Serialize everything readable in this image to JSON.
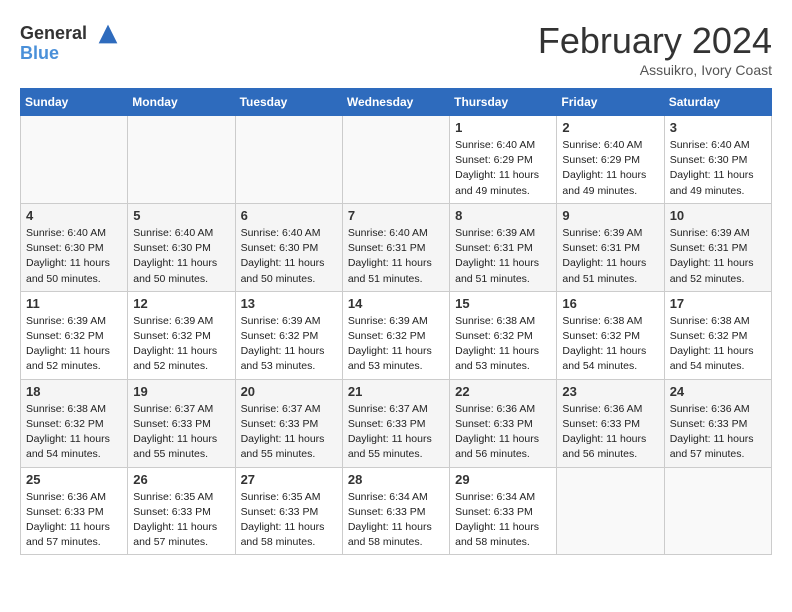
{
  "header": {
    "logo_line1": "General",
    "logo_line2": "Blue",
    "month_title": "February 2024",
    "subtitle": "Assuikro, Ivory Coast"
  },
  "days_of_week": [
    "Sunday",
    "Monday",
    "Tuesday",
    "Wednesday",
    "Thursday",
    "Friday",
    "Saturday"
  ],
  "weeks": [
    [
      {
        "day": "",
        "info": ""
      },
      {
        "day": "",
        "info": ""
      },
      {
        "day": "",
        "info": ""
      },
      {
        "day": "",
        "info": ""
      },
      {
        "day": "1",
        "info": "Sunrise: 6:40 AM\nSunset: 6:29 PM\nDaylight: 11 hours\nand 49 minutes."
      },
      {
        "day": "2",
        "info": "Sunrise: 6:40 AM\nSunset: 6:29 PM\nDaylight: 11 hours\nand 49 minutes."
      },
      {
        "day": "3",
        "info": "Sunrise: 6:40 AM\nSunset: 6:30 PM\nDaylight: 11 hours\nand 49 minutes."
      }
    ],
    [
      {
        "day": "4",
        "info": "Sunrise: 6:40 AM\nSunset: 6:30 PM\nDaylight: 11 hours\nand 50 minutes."
      },
      {
        "day": "5",
        "info": "Sunrise: 6:40 AM\nSunset: 6:30 PM\nDaylight: 11 hours\nand 50 minutes."
      },
      {
        "day": "6",
        "info": "Sunrise: 6:40 AM\nSunset: 6:30 PM\nDaylight: 11 hours\nand 50 minutes."
      },
      {
        "day": "7",
        "info": "Sunrise: 6:40 AM\nSunset: 6:31 PM\nDaylight: 11 hours\nand 51 minutes."
      },
      {
        "day": "8",
        "info": "Sunrise: 6:39 AM\nSunset: 6:31 PM\nDaylight: 11 hours\nand 51 minutes."
      },
      {
        "day": "9",
        "info": "Sunrise: 6:39 AM\nSunset: 6:31 PM\nDaylight: 11 hours\nand 51 minutes."
      },
      {
        "day": "10",
        "info": "Sunrise: 6:39 AM\nSunset: 6:31 PM\nDaylight: 11 hours\nand 52 minutes."
      }
    ],
    [
      {
        "day": "11",
        "info": "Sunrise: 6:39 AM\nSunset: 6:32 PM\nDaylight: 11 hours\nand 52 minutes."
      },
      {
        "day": "12",
        "info": "Sunrise: 6:39 AM\nSunset: 6:32 PM\nDaylight: 11 hours\nand 52 minutes."
      },
      {
        "day": "13",
        "info": "Sunrise: 6:39 AM\nSunset: 6:32 PM\nDaylight: 11 hours\nand 53 minutes."
      },
      {
        "day": "14",
        "info": "Sunrise: 6:39 AM\nSunset: 6:32 PM\nDaylight: 11 hours\nand 53 minutes."
      },
      {
        "day": "15",
        "info": "Sunrise: 6:38 AM\nSunset: 6:32 PM\nDaylight: 11 hours\nand 53 minutes."
      },
      {
        "day": "16",
        "info": "Sunrise: 6:38 AM\nSunset: 6:32 PM\nDaylight: 11 hours\nand 54 minutes."
      },
      {
        "day": "17",
        "info": "Sunrise: 6:38 AM\nSunset: 6:32 PM\nDaylight: 11 hours\nand 54 minutes."
      }
    ],
    [
      {
        "day": "18",
        "info": "Sunrise: 6:38 AM\nSunset: 6:32 PM\nDaylight: 11 hours\nand 54 minutes."
      },
      {
        "day": "19",
        "info": "Sunrise: 6:37 AM\nSunset: 6:33 PM\nDaylight: 11 hours\nand 55 minutes."
      },
      {
        "day": "20",
        "info": "Sunrise: 6:37 AM\nSunset: 6:33 PM\nDaylight: 11 hours\nand 55 minutes."
      },
      {
        "day": "21",
        "info": "Sunrise: 6:37 AM\nSunset: 6:33 PM\nDaylight: 11 hours\nand 55 minutes."
      },
      {
        "day": "22",
        "info": "Sunrise: 6:36 AM\nSunset: 6:33 PM\nDaylight: 11 hours\nand 56 minutes."
      },
      {
        "day": "23",
        "info": "Sunrise: 6:36 AM\nSunset: 6:33 PM\nDaylight: 11 hours\nand 56 minutes."
      },
      {
        "day": "24",
        "info": "Sunrise: 6:36 AM\nSunset: 6:33 PM\nDaylight: 11 hours\nand 57 minutes."
      }
    ],
    [
      {
        "day": "25",
        "info": "Sunrise: 6:36 AM\nSunset: 6:33 PM\nDaylight: 11 hours\nand 57 minutes."
      },
      {
        "day": "26",
        "info": "Sunrise: 6:35 AM\nSunset: 6:33 PM\nDaylight: 11 hours\nand 57 minutes."
      },
      {
        "day": "27",
        "info": "Sunrise: 6:35 AM\nSunset: 6:33 PM\nDaylight: 11 hours\nand 58 minutes."
      },
      {
        "day": "28",
        "info": "Sunrise: 6:34 AM\nSunset: 6:33 PM\nDaylight: 11 hours\nand 58 minutes."
      },
      {
        "day": "29",
        "info": "Sunrise: 6:34 AM\nSunset: 6:33 PM\nDaylight: 11 hours\nand 58 minutes."
      },
      {
        "day": "",
        "info": ""
      },
      {
        "day": "",
        "info": ""
      }
    ]
  ]
}
